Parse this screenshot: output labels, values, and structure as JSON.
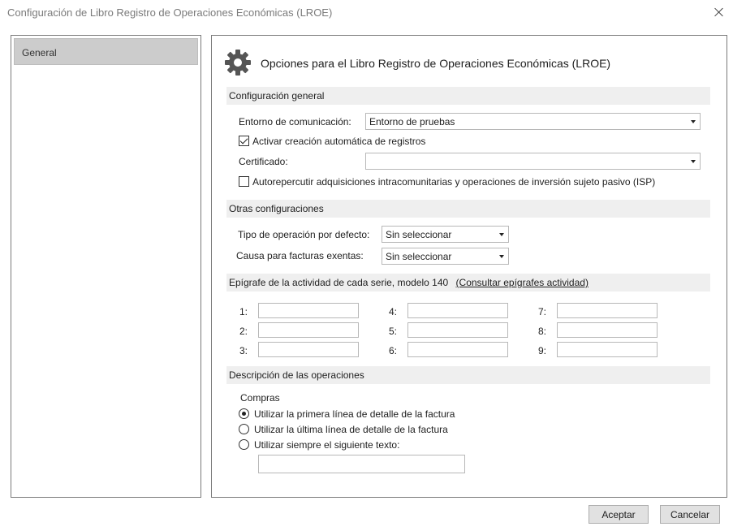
{
  "window": {
    "title": "Configuración de Libro Registro de Operaciones Económicas (LROE)",
    "close_icon": "close-icon"
  },
  "sidebar": {
    "items": [
      {
        "label": "General",
        "selected": true
      }
    ]
  },
  "header": {
    "icon": "gear-icon",
    "title": "Opciones para el Libro Registro de Operaciones Económicas (LROE)"
  },
  "general_config": {
    "section_title": "Configuración general",
    "entorno_label": "Entorno de comunicación:",
    "entorno_value": "Entorno de pruebas",
    "activar_label": "Activar creación automática de registros",
    "activar_checked": true,
    "certificado_label": "Certificado:",
    "certificado_value": "",
    "autorepercutir_label": "Autorepercutir adquisiciones intracomunitarias y operaciones de inversión sujeto pasivo (ISP)",
    "autorepercutir_checked": false
  },
  "other_config": {
    "section_title": "Otras configuraciones",
    "tipo_label": "Tipo de operación por defecto:",
    "tipo_value": "Sin seleccionar",
    "causa_label": "Causa para facturas exentas:",
    "causa_value": "Sin seleccionar"
  },
  "epigrafe": {
    "section_title": "Epígrafe de la actividad de cada serie, modelo 140",
    "link_label": "(Consultar epígrafes actividad)",
    "fields": [
      {
        "label": "1:",
        "value": ""
      },
      {
        "label": "2:",
        "value": ""
      },
      {
        "label": "3:",
        "value": ""
      },
      {
        "label": "4:",
        "value": ""
      },
      {
        "label": "5:",
        "value": ""
      },
      {
        "label": "6:",
        "value": ""
      },
      {
        "label": "7:",
        "value": ""
      },
      {
        "label": "8:",
        "value": ""
      },
      {
        "label": "9:",
        "value": ""
      }
    ]
  },
  "descripcion": {
    "section_title": "Descripción de las operaciones",
    "group_label": "Compras",
    "options": [
      {
        "label": "Utilizar la primera línea de detalle de la factura",
        "selected": true
      },
      {
        "label": "Utilizar la última línea de detalle de la factura",
        "selected": false
      },
      {
        "label": "Utilizar siempre el siguiente texto:",
        "selected": false
      }
    ],
    "custom_text_value": ""
  },
  "footer": {
    "accept_label": "Aceptar",
    "cancel_label": "Cancelar"
  }
}
